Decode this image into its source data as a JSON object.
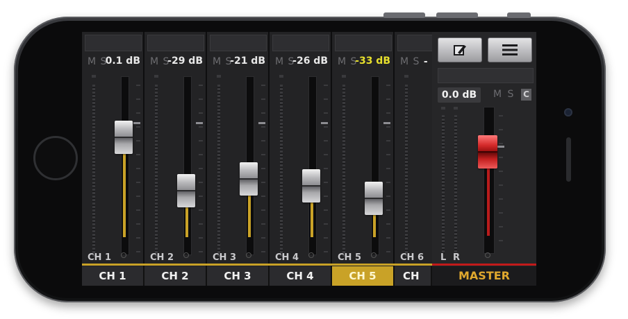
{
  "channels": [
    {
      "name": "CH 1",
      "short": "CH 1",
      "mute": "M",
      "solo": "S",
      "gain": "0.1 dB",
      "level": 0.62,
      "highlight": false,
      "active": false
    },
    {
      "name": "CH 2",
      "short": "CH 2",
      "mute": "M",
      "solo": "S",
      "gain": "-29 dB",
      "level": 0.29,
      "highlight": false,
      "active": false
    },
    {
      "name": "CH 3",
      "short": "CH 3",
      "mute": "M",
      "solo": "S",
      "gain": "-21 dB",
      "level": 0.36,
      "highlight": false,
      "active": false
    },
    {
      "name": "CH 4",
      "short": "CH 4",
      "mute": "M",
      "solo": "S",
      "gain": "-26 dB",
      "level": 0.32,
      "highlight": false,
      "active": false
    },
    {
      "name": "CH 5",
      "short": "CH 5",
      "mute": "M",
      "solo": "S",
      "gain": "-33 dB",
      "level": 0.24,
      "highlight": true,
      "active": true
    },
    {
      "name": "CH",
      "short": "CH 6",
      "mute": "M",
      "solo": "S",
      "gain": "-",
      "level": 0.0,
      "highlight": false,
      "active": false
    }
  ],
  "master": {
    "label": "MASTER",
    "gain": "0.0 dB",
    "mute": "M",
    "solo": "S",
    "clip": "C",
    "left_label": "L",
    "right_label": "R",
    "level": 0.66
  },
  "toolbar": {
    "edit_icon": "edit-icon",
    "menu_icon": "hamburger-menu-icon"
  },
  "colors": {
    "accent": "#c9a227",
    "master_red": "#c21a1a",
    "highlight_text": "#e7e02d",
    "master_label": "#e0a82e"
  }
}
